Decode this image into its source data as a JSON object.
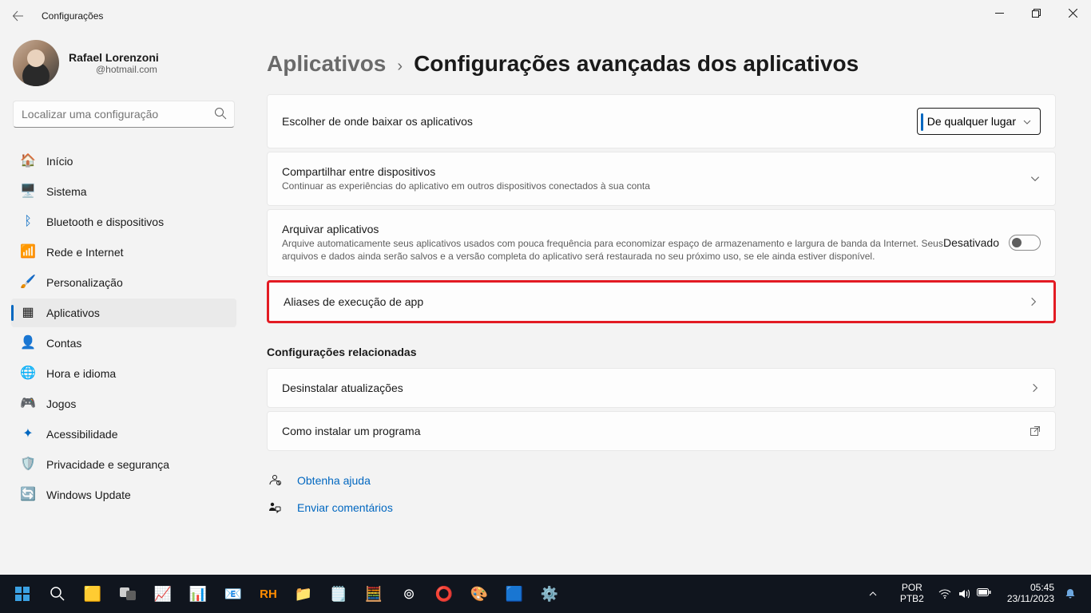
{
  "titlebar": {
    "title": "Configurações"
  },
  "user": {
    "name": "Rafael Lorenzoni",
    "email": "@hotmail.com"
  },
  "search": {
    "placeholder": "Localizar uma configuração"
  },
  "nav": {
    "inicio": "Início",
    "sistema": "Sistema",
    "bluetooth": "Bluetooth e dispositivos",
    "rede": "Rede e Internet",
    "personalizacao": "Personalização",
    "aplicativos": "Aplicativos",
    "contas": "Contas",
    "hora": "Hora e idioma",
    "jogos": "Jogos",
    "acessibilidade": "Acessibilidade",
    "privacidade": "Privacidade e segurança",
    "windowsupdate": "Windows Update"
  },
  "breadcrumb": {
    "parent": "Aplicativos",
    "current": "Configurações avançadas dos aplicativos"
  },
  "cards": {
    "download": {
      "label": "Escolher de onde baixar os aplicativos",
      "dropdown": "De qualquer lugar"
    },
    "share": {
      "label": "Compartilhar entre dispositivos",
      "desc": "Continuar as experiências do aplicativo em outros dispositivos conectados à sua conta"
    },
    "archive": {
      "label": "Arquivar aplicativos",
      "desc": "Arquive automaticamente seus aplicativos usados com pouca frequência para economizar espaço de armazenamento e largura de banda da Internet. Seus arquivos e dados ainda serão salvos e a versão completa do aplicativo será restaurada no seu próximo uso, se ele ainda estiver disponível.",
      "toggle_label": "Desativado"
    },
    "aliases": {
      "label": "Aliases de execução de app"
    }
  },
  "related": {
    "header": "Configurações relacionadas",
    "uninstall": "Desinstalar atualizações",
    "install": "Como instalar um programa"
  },
  "links": {
    "help": "Obtenha ajuda",
    "feedback": "Enviar comentários"
  },
  "taskbar": {
    "lang1": "POR",
    "lang2": "PTB2",
    "time": "05:45",
    "date": "23/11/2023"
  }
}
